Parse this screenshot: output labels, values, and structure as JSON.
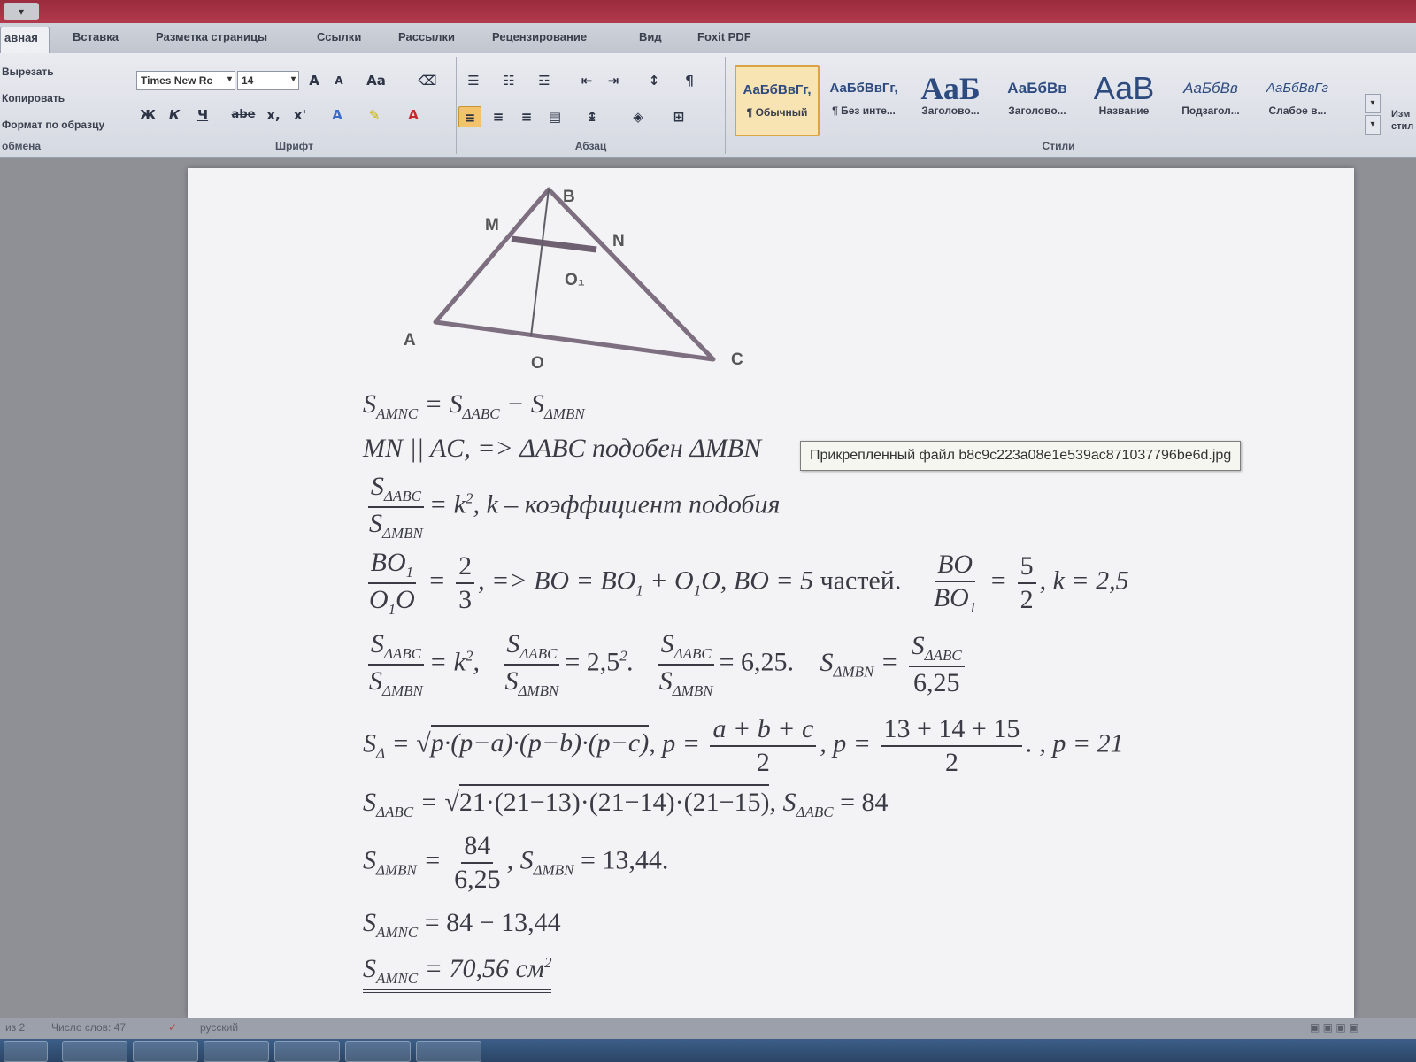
{
  "ribbon": {
    "tabs": [
      "авная",
      "Вставка",
      "Разметка страницы",
      "Ссылки",
      "Рассылки",
      "Рецензирование",
      "Вид",
      "Foxit PDF"
    ],
    "clipboard": {
      "cut": "Вырезать",
      "copy": "Копировать",
      "format_painter": "Формат по образцу",
      "label": "обмена"
    },
    "font": {
      "name": "Times New Rc",
      "size": "14",
      "label": "Шрифт",
      "grow": "A",
      "shrink": "A",
      "case": "Aa",
      "bold": "Ж",
      "italic": "К",
      "underline": "Ч",
      "strike": "abe",
      "subscript": "x,",
      "superscript": "x'"
    },
    "paragraph": {
      "label": "Абзац",
      "pilcrow": "¶"
    },
    "styles": {
      "label": "Стили",
      "items": [
        {
          "sample": "АаБбВвГг,",
          "name": "¶ Обычный"
        },
        {
          "sample": "АаБбВвГг,",
          "name": "¶ Без инте..."
        },
        {
          "sample": "АаБ",
          "name": "Заголово..."
        },
        {
          "sample": "АаБбВв",
          "name": "Заголово..."
        },
        {
          "sample": "АаВ",
          "name": "Название"
        },
        {
          "sample": "АаБбВв",
          "name": "Подзагол..."
        },
        {
          "sample": "АаБбВвГг",
          "name": "Слабое в..."
        }
      ],
      "change_styles": "Изм стил"
    }
  },
  "figure": {
    "labels": {
      "A": "A",
      "B": "B",
      "C": "C",
      "M": "M",
      "N": "N",
      "O": "O",
      "O1": "O₁"
    }
  },
  "document": {
    "line1": {
      "S": "S",
      "sub1": "AMNC",
      "eq": " = S",
      "sub2": "ΔABC",
      "minus": " − S",
      "sub3": "ΔMBN"
    },
    "line2": "MN || AC,   =>   ΔABC подобен ΔMBN",
    "line3": {
      "num": "S",
      "num_sub": "ΔABC",
      "den": "S",
      "den_sub": "ΔMBN",
      "rest": "= k",
      "sup": "2",
      "tail": ",   k – коэффициент подобия"
    },
    "line4": {
      "f1_num": "BO",
      "f1_num_sub": "1",
      "f1_den": "O",
      "f1_den_sub": "1",
      "f1_den_tail": "O",
      "f2_num": "2",
      "f2_den": "3",
      "mid1": ",   => BO = BO",
      "mid1_sub": "1",
      "mid2": " + O",
      "mid2_sub": "1",
      "mid3": "O,   BO = 5 ",
      "parts": "частей.",
      "f3_num": "BO",
      "f3_den": "BO",
      "f3_den_sub": "1",
      "f4_num": "5",
      "f4_den": "2",
      "tail": ",   k = 2,5"
    },
    "line5": {
      "s": "S",
      "abc": "ΔABC",
      "mbn": "ΔMBN",
      "a1": "= k",
      "a1_sup": "2",
      "a2": "= 2,5",
      "a2_sup": "2",
      "a3": "= 6,25.",
      "a4": "6,25"
    },
    "line6": {
      "s": "S",
      "sub": "Δ",
      "eq": " = √",
      "rad": "p·(p−a)·(p−b)·(p−c)",
      "p1": ",   p =",
      "f1_num": "a + b + c",
      "f1_den": "2",
      "p2": ",   p =",
      "f2_num": "13 + 14 + 15",
      "f2_den": "2",
      "tail": ".   ,   p = 21"
    },
    "line7": {
      "s": "S",
      "sub": "ΔABC",
      "eq": " = √",
      "rad": "21·(21−13)·(21−14)·(21−15)",
      "tail": ",   S",
      "tail_sub": "ΔABC",
      "tail_val": " = 84"
    },
    "line8": {
      "s": "S",
      "sub": "ΔMBN",
      "f_num": "84",
      "f_den": "6,25",
      "tail": ",   S",
      "tail_sub": "ΔMBN",
      "tail_val": " = 13,44."
    },
    "line9": {
      "s": "S",
      "sub": "AMNC",
      "val": " = 84 − 13,44"
    },
    "line10": {
      "s": "S",
      "sub": "AMNC",
      "val": " = 70,56 см",
      "sup": "2"
    }
  },
  "tooltip": "Прикрепленный файл b8c9c223a08e1e539ac871037796be6d.jpg",
  "status": {
    "page": "из 2",
    "words": "Число слов: 47",
    "lang": "русский"
  }
}
